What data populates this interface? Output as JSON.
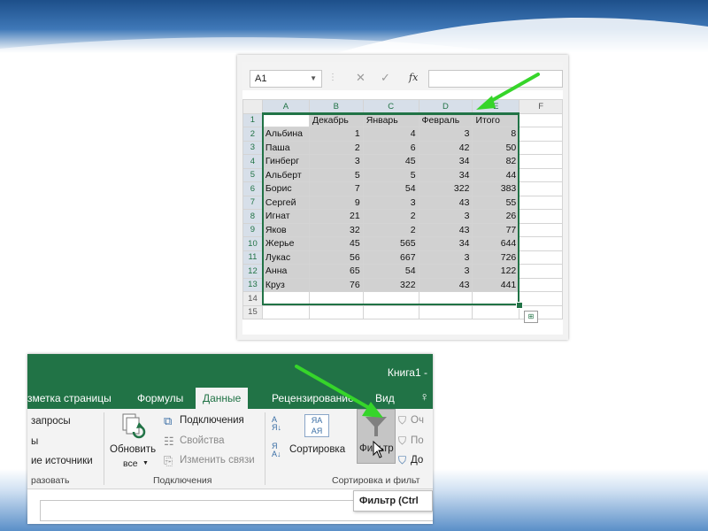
{
  "colors": {
    "excel_green": "#217346",
    "arrow_green": "#36d52a",
    "selection_gray": "#d1d1d1",
    "slide_blue": "#3f78b8"
  },
  "sheet": {
    "name_box": "A1",
    "fx_label": "fx",
    "icons": [
      "cancel-icon",
      "enter-check-icon",
      "function-icon"
    ],
    "columns": [
      "A",
      "B",
      "C",
      "D",
      "E",
      "F"
    ],
    "header_row": [
      "",
      "Декабрь",
      "Январь",
      "Февраль",
      "Итого"
    ],
    "rows": [
      {
        "num": "1"
      },
      {
        "num": "2",
        "name": "Альбина",
        "dec": "1",
        "jan": "4",
        "feb": "3",
        "total": "8"
      },
      {
        "num": "3",
        "name": "Паша",
        "dec": "2",
        "jan": "6",
        "feb": "42",
        "total": "50"
      },
      {
        "num": "4",
        "name": "Гинберг",
        "dec": "3",
        "jan": "45",
        "feb": "34",
        "total": "82"
      },
      {
        "num": "5",
        "name": "Альберт",
        "dec": "5",
        "jan": "5",
        "feb": "34",
        "total": "44"
      },
      {
        "num": "6",
        "name": "Борис",
        "dec": "7",
        "jan": "54",
        "feb": "322",
        "total": "383"
      },
      {
        "num": "7",
        "name": "Сергей",
        "dec": "9",
        "jan": "3",
        "feb": "43",
        "total": "55"
      },
      {
        "num": "8",
        "name": "Игнат",
        "dec": "21",
        "jan": "2",
        "feb": "3",
        "total": "26"
      },
      {
        "num": "9",
        "name": "Яков",
        "dec": "32",
        "jan": "2",
        "feb": "43",
        "total": "77"
      },
      {
        "num": "10",
        "name": "Жерье",
        "dec": "45",
        "jan": "565",
        "feb": "34",
        "total": "644"
      },
      {
        "num": "11",
        "name": "Лукас",
        "dec": "56",
        "jan": "667",
        "feb": "3",
        "total": "726"
      },
      {
        "num": "12",
        "name": "Анна",
        "dec": "65",
        "jan": "54",
        "feb": "3",
        "total": "122"
      },
      {
        "num": "13",
        "name": "Круз",
        "dec": "76",
        "jan": "322",
        "feb": "43",
        "total": "441"
      },
      {
        "num": "14"
      },
      {
        "num": "15"
      }
    ]
  },
  "ribbon": {
    "app_title": "Книга1 -",
    "tabs": [
      "зметка страницы",
      "Формулы",
      "Данные",
      "Рецензирование",
      "Вид"
    ],
    "active_tab": "Данные",
    "queries_group": {
      "items": [
        "запросы",
        "ы",
        "ие источники"
      ],
      "label": "разовать"
    },
    "connections_group": {
      "refresh_label": "Обновить",
      "refresh_sub": "все",
      "items": [
        "Подключения",
        "Свойства",
        "Изменить связи"
      ],
      "label": "Подключения"
    },
    "sort_group": {
      "sort_label": "Сортировка",
      "filter_label": "Фильтр",
      "side_items": [
        "Оч",
        "По",
        "До"
      ],
      "label": "Сортировка и фильт"
    },
    "tooltip": "Фильтр (Ctrl"
  }
}
